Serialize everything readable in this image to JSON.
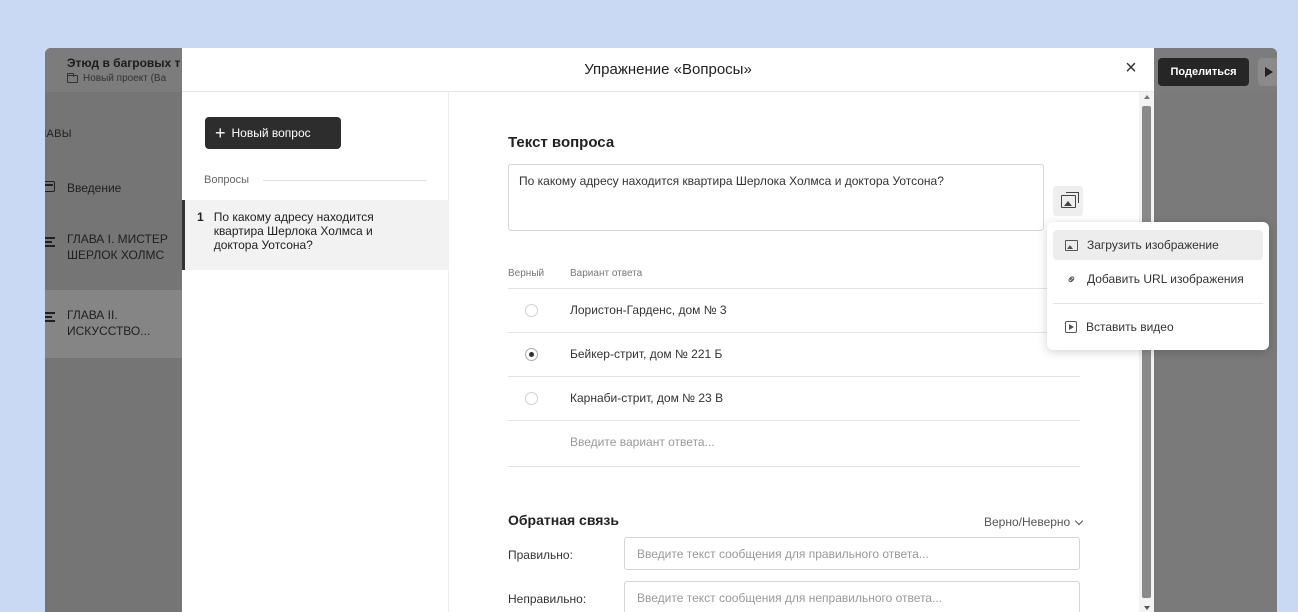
{
  "app": {
    "project_title": "Этюд в багровых т",
    "project_subtitle": "Новый проект (Ва",
    "sidebar_heading": "ЛАВЫ",
    "chapters": [
      {
        "label": "Введение",
        "icon": "document-icon"
      },
      {
        "label": "ГЛАВА I. МИСТЕР ШЕРЛОК ХОЛМС",
        "icon": "lines-icon"
      },
      {
        "label": "ГЛАВА II. ИСКУССТВО...",
        "icon": "lines-icon"
      }
    ],
    "share_label": "Поделиться"
  },
  "modal": {
    "title": "Упражнение «Вопросы»",
    "new_question_label": "Новый вопрос",
    "questions_heading": "Вопросы",
    "questions": [
      {
        "number": "1",
        "text": "По какому адресу находится квартира Шерлока Холмса и доктора Уотсона?"
      }
    ],
    "question_text_heading": "Текст вопроса",
    "question_text_value": "По какому адресу находится квартира Шерлока Холмса и доктора Уотсона?",
    "answers_header_correct": "Верный",
    "answers_header_option": "Вариант ответа",
    "answers": [
      {
        "text": "Лористон-Гарденс, дом № 3",
        "correct": false
      },
      {
        "text": "Бейкер-стрит, дом № 221 Б",
        "correct": true
      },
      {
        "text": "Карнаби-стрит, дом № 23 В",
        "correct": false
      }
    ],
    "answer_placeholder": "Введите вариант ответа...",
    "feedback_heading": "Обратная связь",
    "feedback_mode": "Верно/Неверно",
    "correct_label": "Правильно:",
    "correct_placeholder": "Введите текст сообщения для правильного ответа...",
    "incorrect_label": "Неправильно:",
    "incorrect_placeholder": "Введите текст сообщения для неправильного ответа..."
  },
  "dropdown": {
    "items": [
      {
        "label": "Загрузить изображение",
        "icon": "image-upload-icon"
      },
      {
        "label": "Добавить URL изображения",
        "icon": "link-icon"
      },
      {
        "label": "Вставить видео",
        "icon": "video-icon"
      }
    ]
  }
}
